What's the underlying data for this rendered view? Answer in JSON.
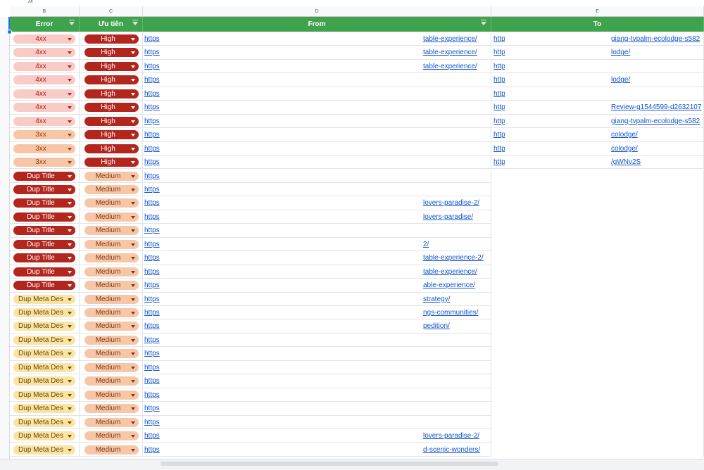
{
  "toolbar": {
    "fx": "fx"
  },
  "columns": {
    "letters": [
      "B",
      "C",
      "D",
      "E"
    ],
    "headers": [
      "Error",
      "Ưu tiên",
      "From",
      "To"
    ]
  },
  "colors": {
    "header_green": "#3fa34d",
    "chip_4xx_bg": "#f8cbc6",
    "chip_4xx_fg": "#b02418",
    "chip_3xx_bg": "#f7c6a6",
    "chip_3xx_fg": "#9c3c12",
    "chip_dup_title_bg": "#b3261e",
    "chip_dup_title_fg": "#ffffff",
    "chip_dup_meta_bg": "#fbe3a4",
    "chip_dup_meta_fg": "#6a4a06",
    "chip_high_bg": "#b3261e",
    "chip_high_fg": "#ffffff",
    "chip_medium_bg": "#f7c6a6",
    "chip_medium_fg": "#7d3a14",
    "link": "#1155cc"
  },
  "rows": [
    {
      "error": "4xx",
      "priority": "High",
      "from_a": "https",
      "from_b": "table-experience/",
      "to_a": "http",
      "to_b": "giang-tvpalm-ecolodge-s582"
    },
    {
      "error": "4xx",
      "priority": "High",
      "from_a": "https",
      "from_b": "table-experience/",
      "to_a": "http",
      "to_b": "lodge/"
    },
    {
      "error": "4xx",
      "priority": "High",
      "from_a": "https",
      "from_b": "table-experience/",
      "to_a": "http",
      "to_b": ""
    },
    {
      "error": "4xx",
      "priority": "High",
      "from_a": "https",
      "from_b": "",
      "to_a": "http",
      "to_b": "lodge/"
    },
    {
      "error": "4xx",
      "priority": "High",
      "from_a": "https",
      "from_b": "",
      "to_a": "http",
      "to_b": ""
    },
    {
      "error": "4xx",
      "priority": "High",
      "from_a": "https",
      "from_b": "",
      "to_a": "http",
      "to_b": "Review-g1544599-d2632107"
    },
    {
      "error": "4xx",
      "priority": "High",
      "from_a": "https",
      "from_b": "",
      "to_a": "http",
      "to_b": "giang-tvpalm-ecolodge-s582"
    },
    {
      "error": "3xx",
      "priority": "High",
      "from_a": "https",
      "from_b": "",
      "to_a": "http",
      "to_b": "colodge/"
    },
    {
      "error": "3xx",
      "priority": "High",
      "from_a": "https",
      "from_b": "",
      "to_a": "http",
      "to_b": "colodge/"
    },
    {
      "error": "3xx",
      "priority": "High",
      "from_a": "https",
      "from_b": "",
      "to_a": "http",
      "to_b": "/gWNv2S"
    },
    {
      "error": "Dup Title",
      "priority": "Medium",
      "from_a": "https",
      "from_b": "",
      "to_a": "",
      "to_b": ""
    },
    {
      "error": "Dup Title",
      "priority": "Medium",
      "from_a": "https",
      "from_b": "",
      "to_a": "",
      "to_b": ""
    },
    {
      "error": "Dup Title",
      "priority": "Medium",
      "from_a": "https",
      "from_b": "lovers-paradise-2/",
      "to_a": "",
      "to_b": ""
    },
    {
      "error": "Dup Title",
      "priority": "Medium",
      "from_a": "https",
      "from_b": "lovers-paradise/",
      "to_a": "",
      "to_b": ""
    },
    {
      "error": "Dup Title",
      "priority": "Medium",
      "from_a": "https",
      "from_b": "",
      "to_a": "",
      "to_b": ""
    },
    {
      "error": "Dup Title",
      "priority": "Medium",
      "from_a": "https",
      "from_b": "2/",
      "to_a": "",
      "to_b": ""
    },
    {
      "error": "Dup Title",
      "priority": "Medium",
      "from_a": "https",
      "from_b": "table-experience-2/",
      "to_a": "",
      "to_b": ""
    },
    {
      "error": "Dup Title",
      "priority": "Medium",
      "from_a": "https",
      "from_b": "table-experience/",
      "to_a": "",
      "to_b": ""
    },
    {
      "error": "Dup Title",
      "priority": "Medium",
      "from_a": "https",
      "from_b": "able-experience/",
      "to_a": "",
      "to_b": ""
    },
    {
      "error": "Dup Meta Des",
      "priority": "Medium",
      "from_a": "https",
      "from_b": "strategy/",
      "to_a": "",
      "to_b": ""
    },
    {
      "error": "Dup Meta Des",
      "priority": "Medium",
      "from_a": "https",
      "from_b": "ngs-communities/",
      "to_a": "",
      "to_b": ""
    },
    {
      "error": "Dup Meta Des",
      "priority": "Medium",
      "from_a": "https",
      "from_b": "pedition/",
      "to_a": "",
      "to_b": ""
    },
    {
      "error": "Dup Meta Des",
      "priority": "Medium",
      "from_a": "https",
      "from_b": "",
      "to_a": "",
      "to_b": ""
    },
    {
      "error": "Dup Meta Des",
      "priority": "Medium",
      "from_a": "https",
      "from_b": "",
      "to_a": "",
      "to_b": ""
    },
    {
      "error": "Dup Meta Des",
      "priority": "Medium",
      "from_a": "https",
      "from_b": "",
      "to_a": "",
      "to_b": ""
    },
    {
      "error": "Dup Meta Des",
      "priority": "Medium",
      "from_a": "https",
      "from_b": "",
      "to_a": "",
      "to_b": ""
    },
    {
      "error": "Dup Meta Des",
      "priority": "Medium",
      "from_a": "https",
      "from_b": "",
      "to_a": "",
      "to_b": ""
    },
    {
      "error": "Dup Meta Des",
      "priority": "Medium",
      "from_a": "https",
      "from_b": "",
      "to_a": "",
      "to_b": ""
    },
    {
      "error": "Dup Meta Des",
      "priority": "Medium",
      "from_a": "https",
      "from_b": "",
      "to_a": "",
      "to_b": ""
    },
    {
      "error": "Dup Meta Des",
      "priority": "Medium",
      "from_a": "https",
      "from_b": "lovers-paradise-2/",
      "to_a": "",
      "to_b": ""
    },
    {
      "error": "Dup Meta Des",
      "priority": "Medium",
      "from_a": "https",
      "from_b": "d-scenic-wonders/",
      "to_a": "",
      "to_b": ""
    }
  ]
}
